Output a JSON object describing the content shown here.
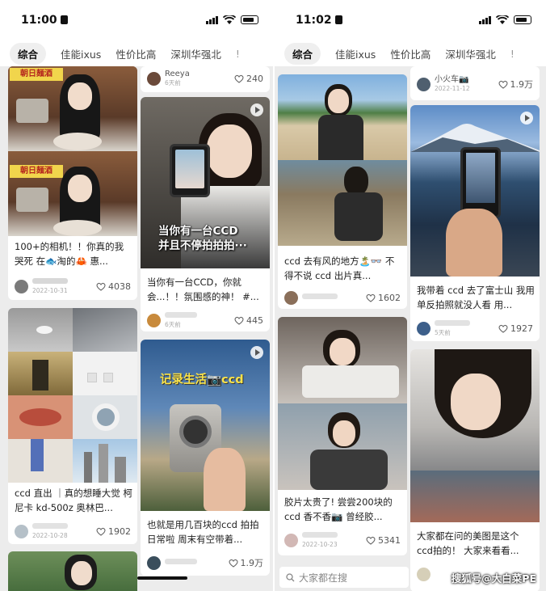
{
  "left": {
    "time": "11:00",
    "tabs": [
      "综合",
      "佳能ixus",
      "性价比高",
      "深圳华强北",
      "!"
    ],
    "cards": [
      {
        "title": "100+的相机！！你真的我哭死 在🐟淘的🦀 惠...",
        "date": "2022-10-31",
        "likes": "4038",
        "sign_top": "朝日麺酒",
        "sign_bottom": "朝日麺酒"
      },
      {
        "title": "ccd 直出 ｜真的想睡大觉 柯尼卡 kd-500z 奥林巴...",
        "date": "2022-10-28",
        "likes": "1902"
      },
      {
        "user": "Reeya",
        "date": "6天前",
        "likes": "240"
      },
      {
        "title": "当你有一台CCD，你就会...！！氛围感的神！ #...",
        "date": "6天前",
        "likes": "445",
        "overlay": [
          "当你有一台CCD",
          "并且不停拍拍拍···"
        ]
      },
      {
        "title": "也就是用几百块的ccd 拍拍日常啦 周末有空带着...",
        "likes": "1.9万",
        "overlay": [
          "记录生活📷ccd"
        ]
      }
    ]
  },
  "right": {
    "time": "11:02",
    "tabs": [
      "综合",
      "佳能ixus",
      "性价比高",
      "深圳华强北",
      "!"
    ],
    "cards": [
      {
        "title": "ccd 去有风的地方🏝️👓 不得不说 ccd 出片真...",
        "likes": "1602"
      },
      {
        "title": "胶片太贵了! 尝尝200块的ccd 香不香📷 曾经胶...",
        "date": "2022-10-23",
        "likes": "5341"
      },
      {
        "user": "小火车📷",
        "date": "2022-11-12",
        "likes": "1.9万"
      },
      {
        "title": "我带着 ccd 去了富士山 我用单反拍照就没人看 用...",
        "date": "5天前",
        "likes": "1927"
      },
      {
        "title": "大家都在问的美图是这个 ccd拍的！ 大家来看看..."
      }
    ],
    "search_placeholder": "大家都在搜",
    "watermark": "搜狐号@大白菜PE"
  }
}
